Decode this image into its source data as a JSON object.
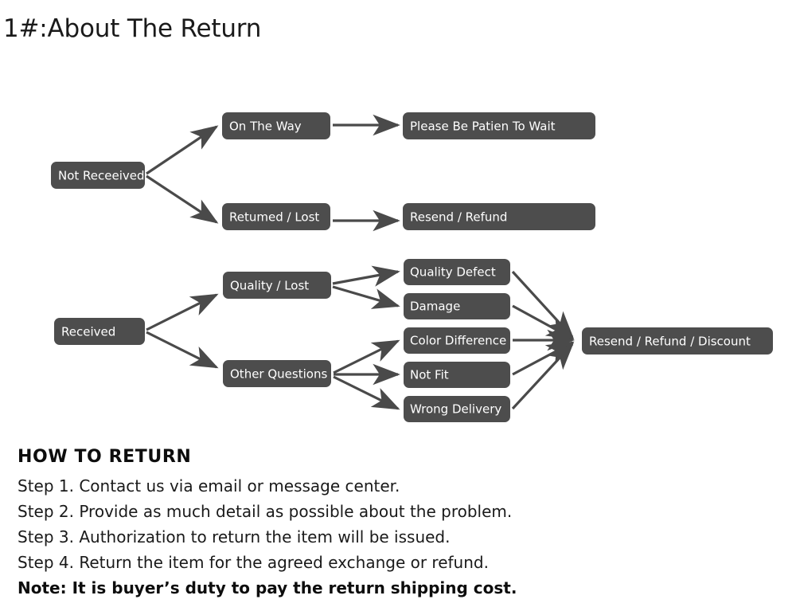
{
  "page_title": "1#:About The Return",
  "colors": {
    "node_fill": "#4d4d4d",
    "node_text": "#ffffff",
    "edge": "#4a4a4a",
    "background": "#ffffff",
    "body_text": "#1a1a1a"
  },
  "flowchart": {
    "type": "diagram",
    "branches": [
      {
        "id": "not-received",
        "root": "Not Receeived",
        "paths": [
          {
            "stage": "On The Way",
            "outcome": "Please Be Patien To Wait"
          },
          {
            "stage": "Retumed / Lost",
            "outcome": "Resend / Refund"
          }
        ]
      },
      {
        "id": "received",
        "root": "Received",
        "paths": [
          {
            "stage": "Quality / Lost",
            "reasons": [
              "Quality Defect",
              "Damage"
            ]
          },
          {
            "stage": "Other Questions",
            "reasons": [
              "Color Difference",
              "Not Fit",
              "Wrong Delivery"
            ]
          }
        ],
        "outcome": "Resend / Refund / Discount"
      }
    ],
    "nodes": {
      "not_received": "Not Receeived",
      "on_the_way": "On The Way",
      "returned_lost": "Retumed / Lost",
      "please_wait": "Please Be Patien To Wait",
      "resend_refund": "Resend / Refund",
      "received": "Received",
      "quality_lost": "Quality / Lost",
      "other_questions": "Other Questions",
      "quality_defect": "Quality Defect",
      "damage": "Damage",
      "color_difference": "Color Difference",
      "not_fit": "Not Fit",
      "wrong_delivery": "Wrong Delivery",
      "resend_refund_discount": "Resend / Refund / Discount"
    }
  },
  "how_to_return": {
    "heading": "HOW TO RETURN",
    "steps": [
      "Step 1. Contact us via email or message center.",
      "Step 2. Provide as much detail as possible about the problem.",
      "Step 3. Authorization to return the item will be issued.",
      "Step 4. Return the item for the agreed exchange or refund."
    ],
    "note": "Note: It is buyer’s duty to pay the return shipping cost."
  }
}
